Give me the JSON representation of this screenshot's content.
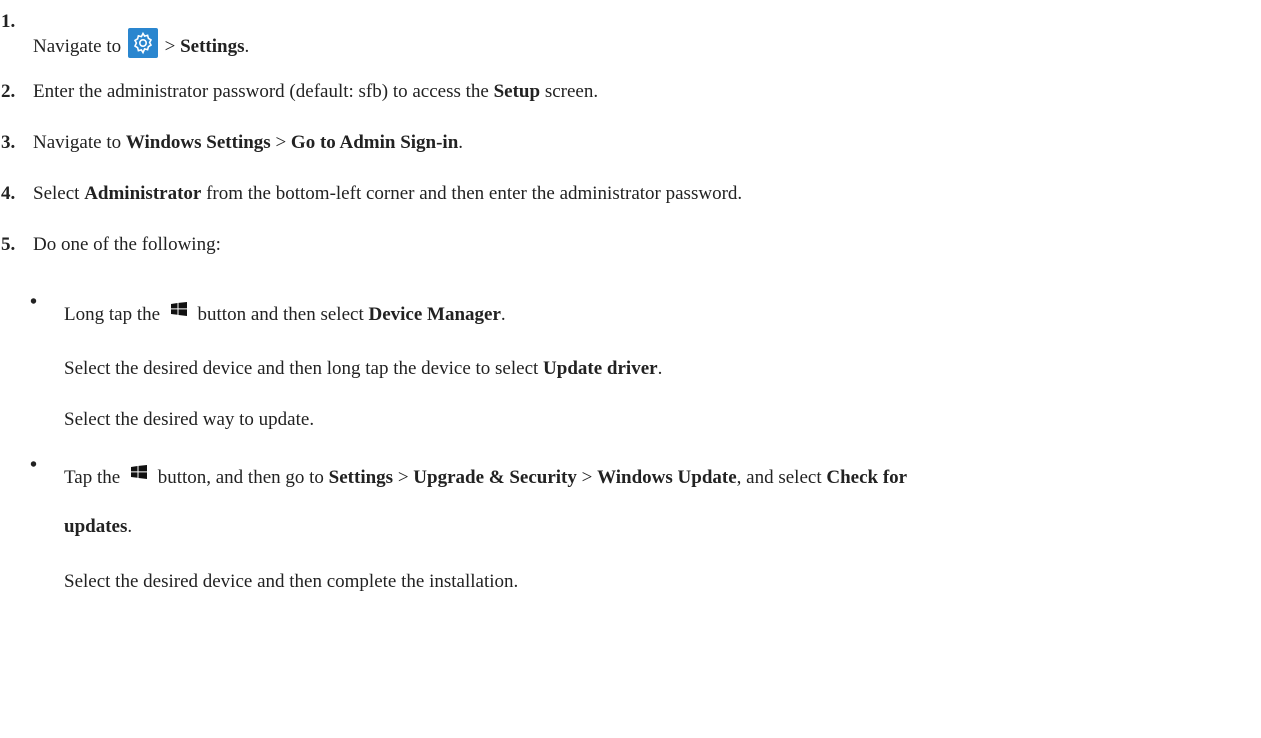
{
  "steps": [
    {
      "num": "1.",
      "t1": "Navigate to ",
      "t2": " > ",
      "b1": "Settings",
      "t3": "."
    },
    {
      "num": "2.",
      "t1": "Enter the administrator password (default: sfb) to access the ",
      "b1": "Setup",
      "t2": " screen."
    },
    {
      "num": "3.",
      "t1": "Navigate to ",
      "b1": "Windows Settings",
      "t2": " > ",
      "b2": "Go to Admin Sign-in",
      "t3": "."
    },
    {
      "num": "4.",
      "t1": "Select ",
      "b1": "Administrator",
      "t2": "  from the bottom-left corner and then enter the administrator password."
    },
    {
      "num": "5.",
      "t1": "Do one of the following:"
    }
  ],
  "options": [
    {
      "bullet": "•",
      "l1_t1": "Long tap the ",
      "l1_t2": " button and then select ",
      "l1_b1": "Device Manager",
      "l1_t3": ".",
      "l2_t1": "Select the desired device and then long tap the device to select ",
      "l2_b1": "Update driver",
      "l2_t2": ".",
      "l3": "Select the desired way to update."
    },
    {
      "bullet": "•",
      "l1_t1": "Tap the ",
      "l1_t2": " button, and then go to ",
      "l1_b1": "Settings",
      "l1_t3": " > ",
      "l1_b2": "Upgrade & Security",
      "l1_t4": " > ",
      "l1_b3": "Windows Update",
      "l1_t5": ", and select ",
      "l1_b4": "Check for",
      "l2_b1": "updates",
      "l2_t1": ".",
      "l3": "Select the desired device and then complete the installation."
    }
  ],
  "icons": {
    "gear": "gear-icon",
    "windows": "windows-logo-icon"
  },
  "colors": {
    "gear_bg": "#2a86cf",
    "text": "#222222"
  }
}
